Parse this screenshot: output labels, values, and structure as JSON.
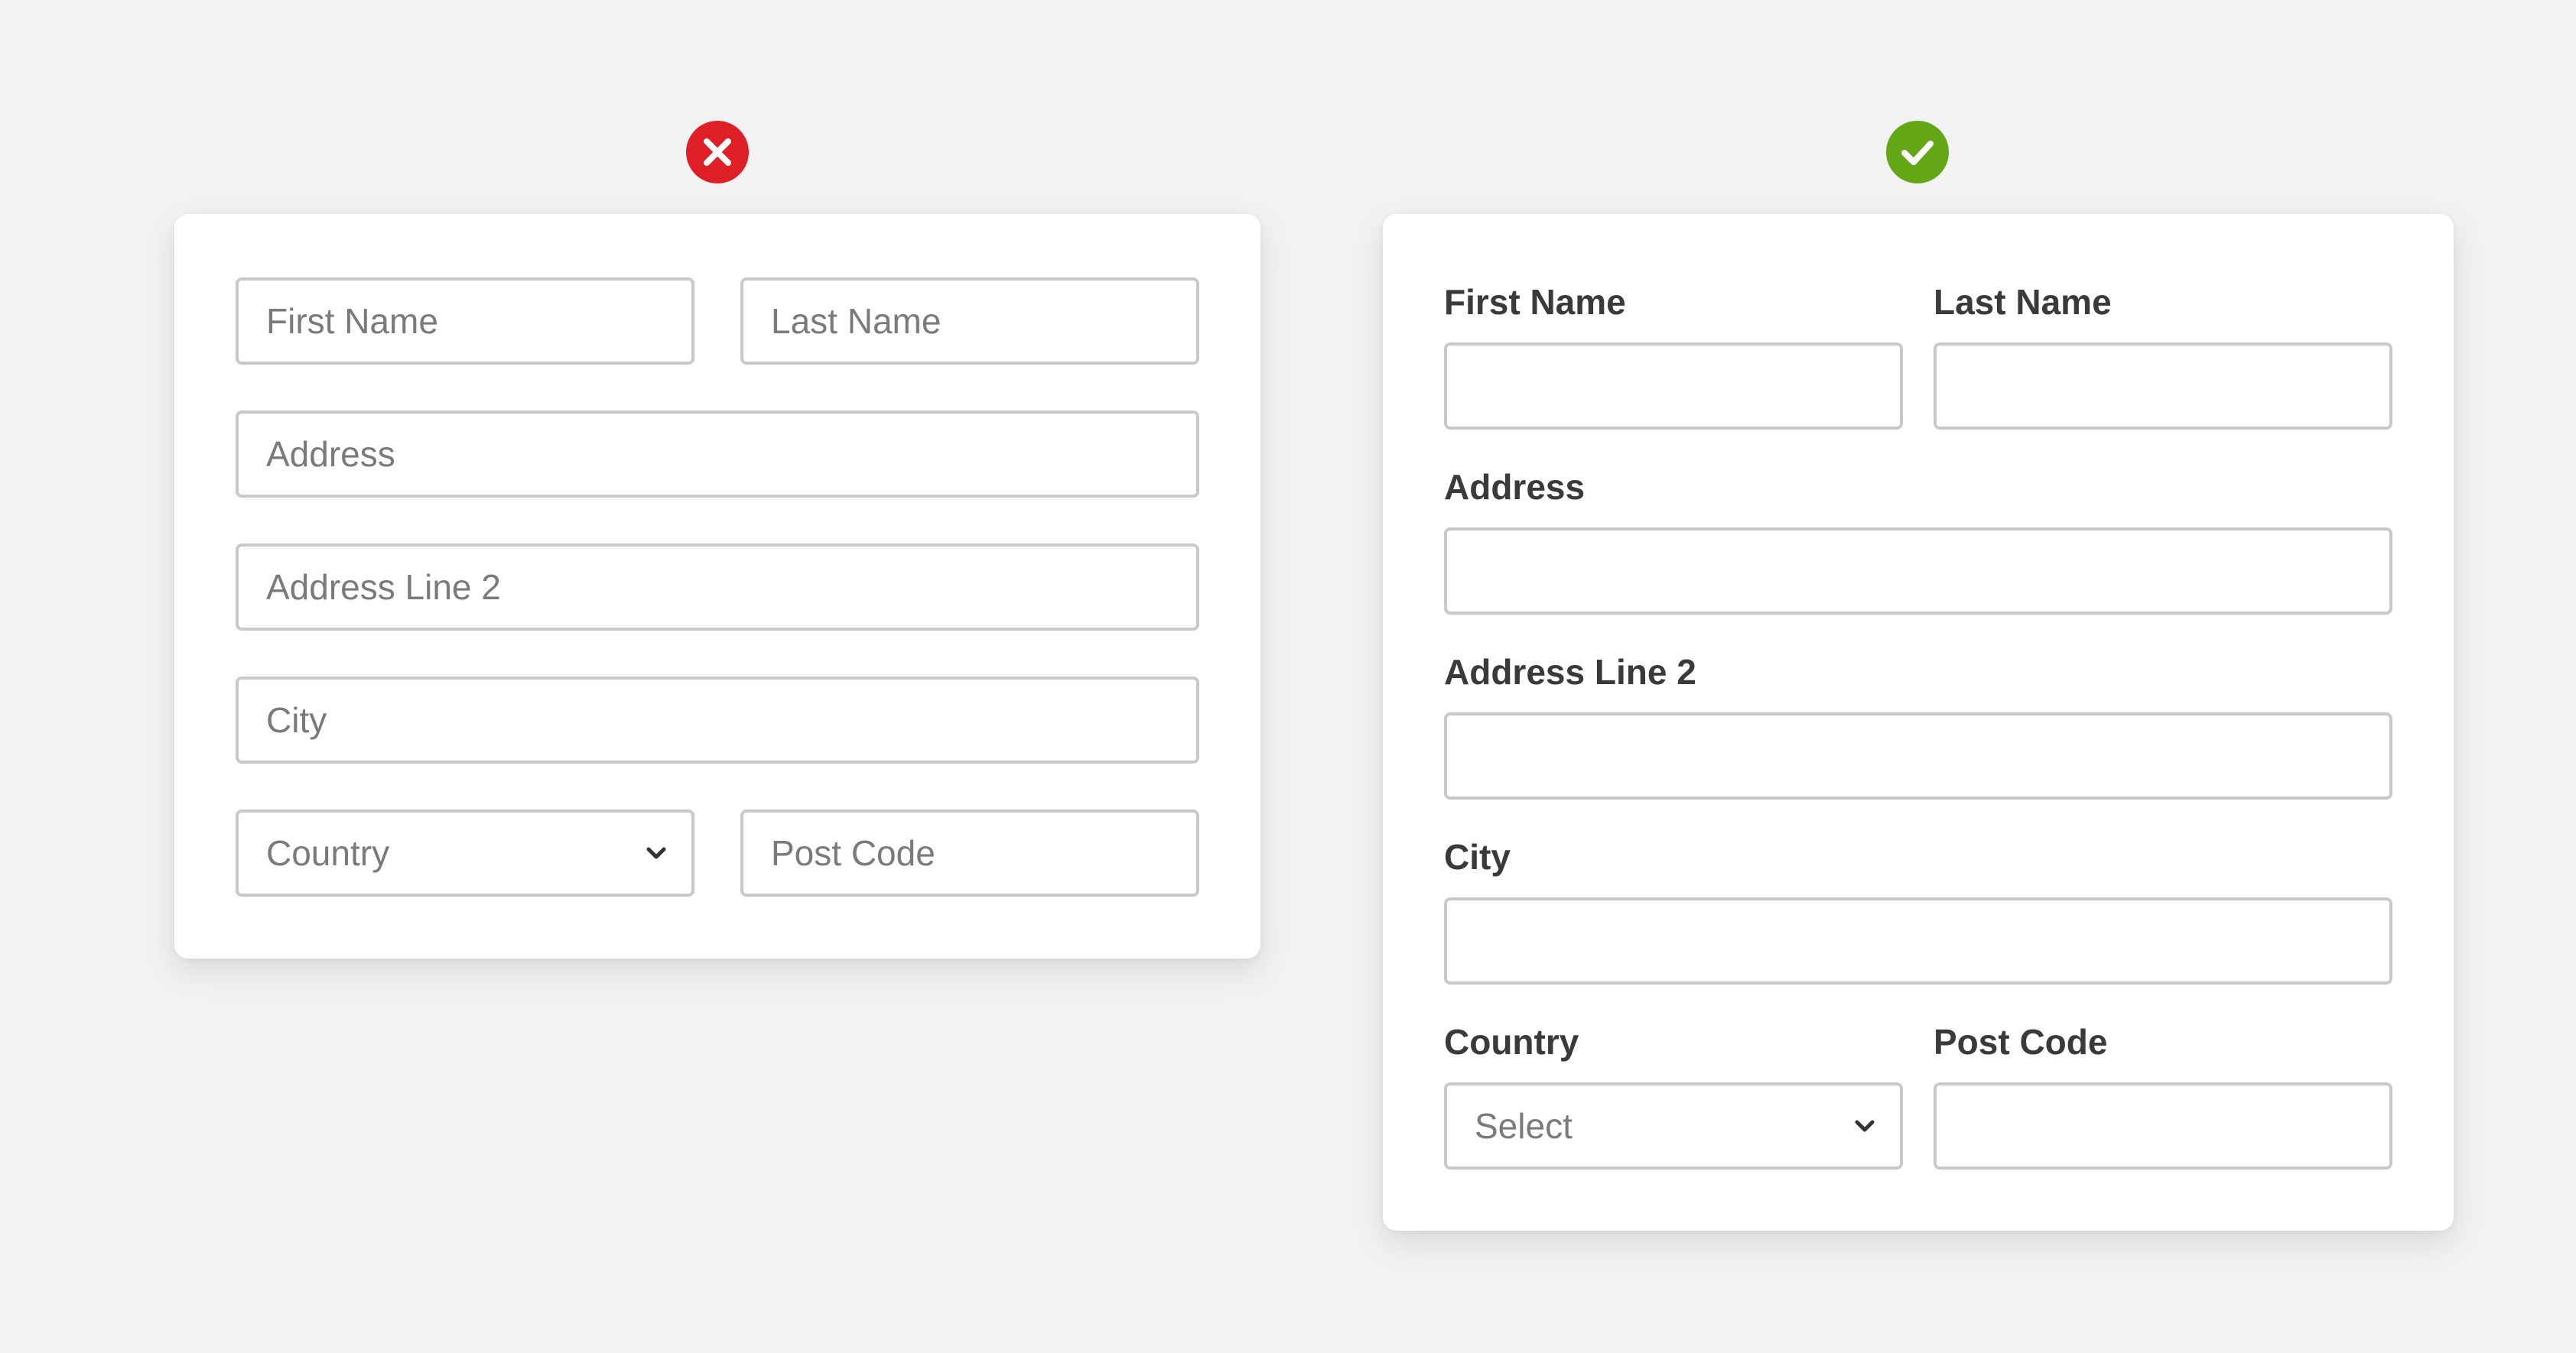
{
  "colors": {
    "error": "#de1f25",
    "success": "#63a716",
    "background": "#f2f2f2",
    "border": "#c9c9c9"
  },
  "bad_example": {
    "status_icon": "close-icon",
    "fields": {
      "first_name_placeholder": "First Name",
      "last_name_placeholder": "Last Name",
      "address_placeholder": "Address",
      "address_line2_placeholder": "Address Line 2",
      "city_placeholder": "City",
      "country_placeholder": "Country",
      "post_code_placeholder": "Post Code"
    }
  },
  "good_example": {
    "status_icon": "check-icon",
    "labels": {
      "first_name": "First Name",
      "last_name": "Last Name",
      "address": "Address",
      "address_line2": "Address Line 2",
      "city": "City",
      "country": "Country",
      "post_code": "Post Code"
    },
    "country_select_value": "Select"
  }
}
